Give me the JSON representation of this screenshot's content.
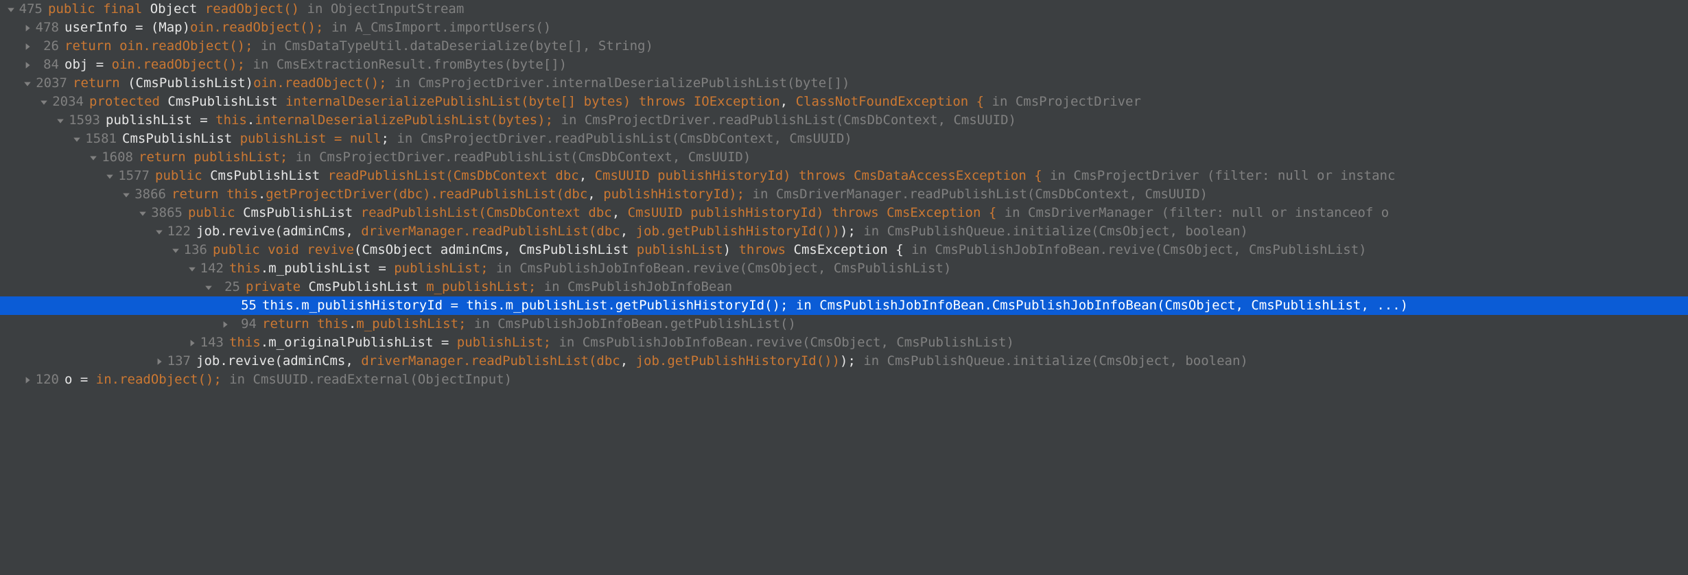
{
  "rows": [
    {
      "indent": 0,
      "arrow": "down",
      "selected": false,
      "num": "475",
      "tokens": [
        [
          "kw",
          "public final "
        ],
        [
          "white",
          "Object "
        ],
        [
          "kw",
          "readObject() "
        ],
        [
          "grey",
          "in ObjectInputStream"
        ]
      ]
    },
    {
      "indent": 1,
      "arrow": "right",
      "selected": false,
      "num": "478",
      "tokens": [
        [
          "white",
          "userInfo = (Map)"
        ],
        [
          "kw",
          "oin.readObject();"
        ],
        [
          "grey",
          " in A_CmsImport.importUsers()"
        ]
      ]
    },
    {
      "indent": 1,
      "arrow": "right",
      "selected": false,
      "num": "26",
      "tokens": [
        [
          "kw",
          "return "
        ],
        [
          "kw",
          "oin.readObject();"
        ],
        [
          "grey",
          " in CmsDataTypeUtil.dataDeserialize(byte[], String)"
        ]
      ]
    },
    {
      "indent": 1,
      "arrow": "right",
      "selected": false,
      "num": "84",
      "tokens": [
        [
          "white",
          "obj = "
        ],
        [
          "kw",
          "oin.readObject();"
        ],
        [
          "grey",
          " in CmsExtractionResult.fromBytes(byte[])"
        ]
      ]
    },
    {
      "indent": 1,
      "arrow": "down",
      "selected": false,
      "num": "2037",
      "tokens": [
        [
          "kw",
          "return "
        ],
        [
          "white",
          "(CmsPublishList)"
        ],
        [
          "kw",
          "oin.readObject();"
        ],
        [
          "grey",
          " in CmsProjectDriver.internalDeserializePublishList(byte[])"
        ]
      ]
    },
    {
      "indent": 2,
      "arrow": "down",
      "selected": false,
      "num": "2034",
      "tokens": [
        [
          "kw",
          "protected "
        ],
        [
          "white",
          "CmsPublishList "
        ],
        [
          "kw",
          "internalDeserializePublishList("
        ],
        [
          "kw",
          "byte"
        ],
        [
          "kw",
          "[] bytes) "
        ],
        [
          "kw",
          "throws "
        ],
        [
          "kw",
          "IOException"
        ],
        [
          "white",
          ", "
        ],
        [
          "kw",
          "ClassNotFoundException {"
        ],
        [
          "grey",
          " in CmsProjectDriver"
        ]
      ]
    },
    {
      "indent": 3,
      "arrow": "down",
      "selected": false,
      "num": "1593",
      "tokens": [
        [
          "white",
          "publishList = "
        ],
        [
          "kw",
          "this"
        ],
        [
          "white",
          "."
        ],
        [
          "kw",
          "internalDeserializePublishList(bytes);"
        ],
        [
          "grey",
          " in CmsProjectDriver.readPublishList(CmsDbContext, CmsUUID)"
        ]
      ]
    },
    {
      "indent": 4,
      "arrow": "down",
      "selected": false,
      "num": "1581",
      "tokens": [
        [
          "white",
          "CmsPublishList "
        ],
        [
          "kw",
          "publishList = "
        ],
        [
          "kw",
          "null"
        ],
        [
          "white",
          ";"
        ],
        [
          "grey",
          " in CmsProjectDriver.readPublishList(CmsDbContext, CmsUUID)"
        ]
      ]
    },
    {
      "indent": 5,
      "arrow": "down",
      "selected": false,
      "num": "1608",
      "tokens": [
        [
          "kw",
          "return "
        ],
        [
          "kw",
          "publishList;"
        ],
        [
          "grey",
          " in CmsProjectDriver.readPublishList(CmsDbContext, CmsUUID)"
        ]
      ]
    },
    {
      "indent": 6,
      "arrow": "down",
      "selected": false,
      "num": "1577",
      "tokens": [
        [
          "kw",
          "public "
        ],
        [
          "white",
          "CmsPublishList "
        ],
        [
          "kw",
          "readPublishList(CmsDbContext dbc"
        ],
        [
          "white",
          ", "
        ],
        [
          "kw",
          "CmsUUID publishHistoryId) "
        ],
        [
          "kw",
          "throws "
        ],
        [
          "kw",
          "CmsDataAccessException {"
        ],
        [
          "grey",
          " in CmsProjectDriver (filter: null or instanc"
        ]
      ]
    },
    {
      "indent": 7,
      "arrow": "down",
      "selected": false,
      "num": "3866",
      "tokens": [
        [
          "kw",
          "return "
        ],
        [
          "kw",
          "this"
        ],
        [
          "white",
          "."
        ],
        [
          "kw",
          "getProjectDriver(dbc).readPublishList(dbc"
        ],
        [
          "white",
          ", "
        ],
        [
          "kw",
          "publishHistoryId);"
        ],
        [
          "grey",
          " in CmsDriverManager.readPublishList(CmsDbContext, CmsUUID)"
        ]
      ]
    },
    {
      "indent": 8,
      "arrow": "down",
      "selected": false,
      "num": "3865",
      "tokens": [
        [
          "kw",
          "public "
        ],
        [
          "white",
          "CmsPublishList "
        ],
        [
          "kw",
          "readPublishList(CmsDbContext dbc"
        ],
        [
          "white",
          ", "
        ],
        [
          "kw",
          "CmsUUID publishHistoryId) "
        ],
        [
          "kw",
          "throws "
        ],
        [
          "kw",
          "CmsException {"
        ],
        [
          "grey",
          " in CmsDriverManager (filter: null or instanceof o"
        ]
      ]
    },
    {
      "indent": 9,
      "arrow": "down",
      "selected": false,
      "num": "122",
      "tokens": [
        [
          "white",
          "job.revive(adminCms, "
        ],
        [
          "kw",
          "driverManager.readPublishList(dbc"
        ],
        [
          "white",
          ", "
        ],
        [
          "kw",
          "job.getPublishHistoryId())"
        ],
        [
          "white",
          ");"
        ],
        [
          "grey",
          " in CmsPublishQueue.initialize(CmsObject, boolean)"
        ]
      ]
    },
    {
      "indent": 10,
      "arrow": "down",
      "selected": false,
      "num": "136",
      "tokens": [
        [
          "kw",
          "public void "
        ],
        [
          "kw",
          "revive"
        ],
        [
          "white",
          "(CmsObject adminCms, CmsPublishList "
        ],
        [
          "kw",
          "publishList"
        ],
        [
          "white",
          ") "
        ],
        [
          "kw",
          "throws "
        ],
        [
          "white",
          "CmsException {"
        ],
        [
          "grey",
          " in CmsPublishJobInfoBean.revive(CmsObject, CmsPublishList)"
        ]
      ]
    },
    {
      "indent": 11,
      "arrow": "down",
      "selected": false,
      "num": "142",
      "tokens": [
        [
          "kw",
          "this"
        ],
        [
          "white",
          ".m_publishList = "
        ],
        [
          "kw",
          "publishList;"
        ],
        [
          "grey",
          " in CmsPublishJobInfoBean.revive(CmsObject, CmsPublishList)"
        ]
      ]
    },
    {
      "indent": 12,
      "arrow": "down",
      "selected": false,
      "num": "25",
      "tokens": [
        [
          "kw",
          "private "
        ],
        [
          "white",
          "CmsPublishList "
        ],
        [
          "kw",
          "m_publishList;"
        ],
        [
          "grey",
          " in CmsPublishJobInfoBean"
        ]
      ]
    },
    {
      "indent": 13,
      "arrow": "none",
      "selected": true,
      "num": "55",
      "tokens": [
        [
          "white",
          "this.m_publishHistoryId = this.m_publishList."
        ],
        [
          "kw",
          "getPublishHistoryId"
        ],
        [
          "white",
          "();"
        ],
        [
          "grey",
          " in "
        ],
        [
          "kw",
          "CmsPublishJobInfoBean.CmsPublishJobInfoBean(CmsObject, CmsPublishList, ...)"
        ]
      ]
    },
    {
      "indent": 13,
      "arrow": "right",
      "selected": false,
      "num": "94",
      "tokens": [
        [
          "kw",
          "return "
        ],
        [
          "kw",
          "this"
        ],
        [
          "white",
          "."
        ],
        [
          "kw",
          "m_publishList;"
        ],
        [
          "grey",
          " in CmsPublishJobInfoBean.getPublishList()"
        ]
      ]
    },
    {
      "indent": 11,
      "arrow": "right",
      "selected": false,
      "num": "143",
      "tokens": [
        [
          "kw",
          "this"
        ],
        [
          "white",
          ".m_originalPublishList = "
        ],
        [
          "kw",
          "publishList;"
        ],
        [
          "grey",
          " in CmsPublishJobInfoBean.revive(CmsObject, CmsPublishList)"
        ]
      ]
    },
    {
      "indent": 9,
      "arrow": "right",
      "selected": false,
      "num": "137",
      "tokens": [
        [
          "white",
          "job.revive(adminCms, "
        ],
        [
          "kw",
          "driverManager.readPublishList(dbc"
        ],
        [
          "white",
          ", "
        ],
        [
          "kw",
          "job.getPublishHistoryId())"
        ],
        [
          "white",
          ");"
        ],
        [
          "grey",
          " in CmsPublishQueue.initialize(CmsObject, boolean)"
        ]
      ]
    },
    {
      "indent": 1,
      "arrow": "right",
      "selected": false,
      "num": "120",
      "tokens": [
        [
          "white",
          "o = "
        ],
        [
          "kw",
          "in.readObject();"
        ],
        [
          "grey",
          " in CmsUUID.readExternal(ObjectInput)"
        ]
      ]
    }
  ],
  "colors": {
    "bg": "#3c3f41",
    "sel": "#0b5cd6",
    "kw": "#cc7832",
    "grey": "#808080",
    "white": "#e6e6e6"
  },
  "indentStep": 24,
  "numWidth": 5
}
